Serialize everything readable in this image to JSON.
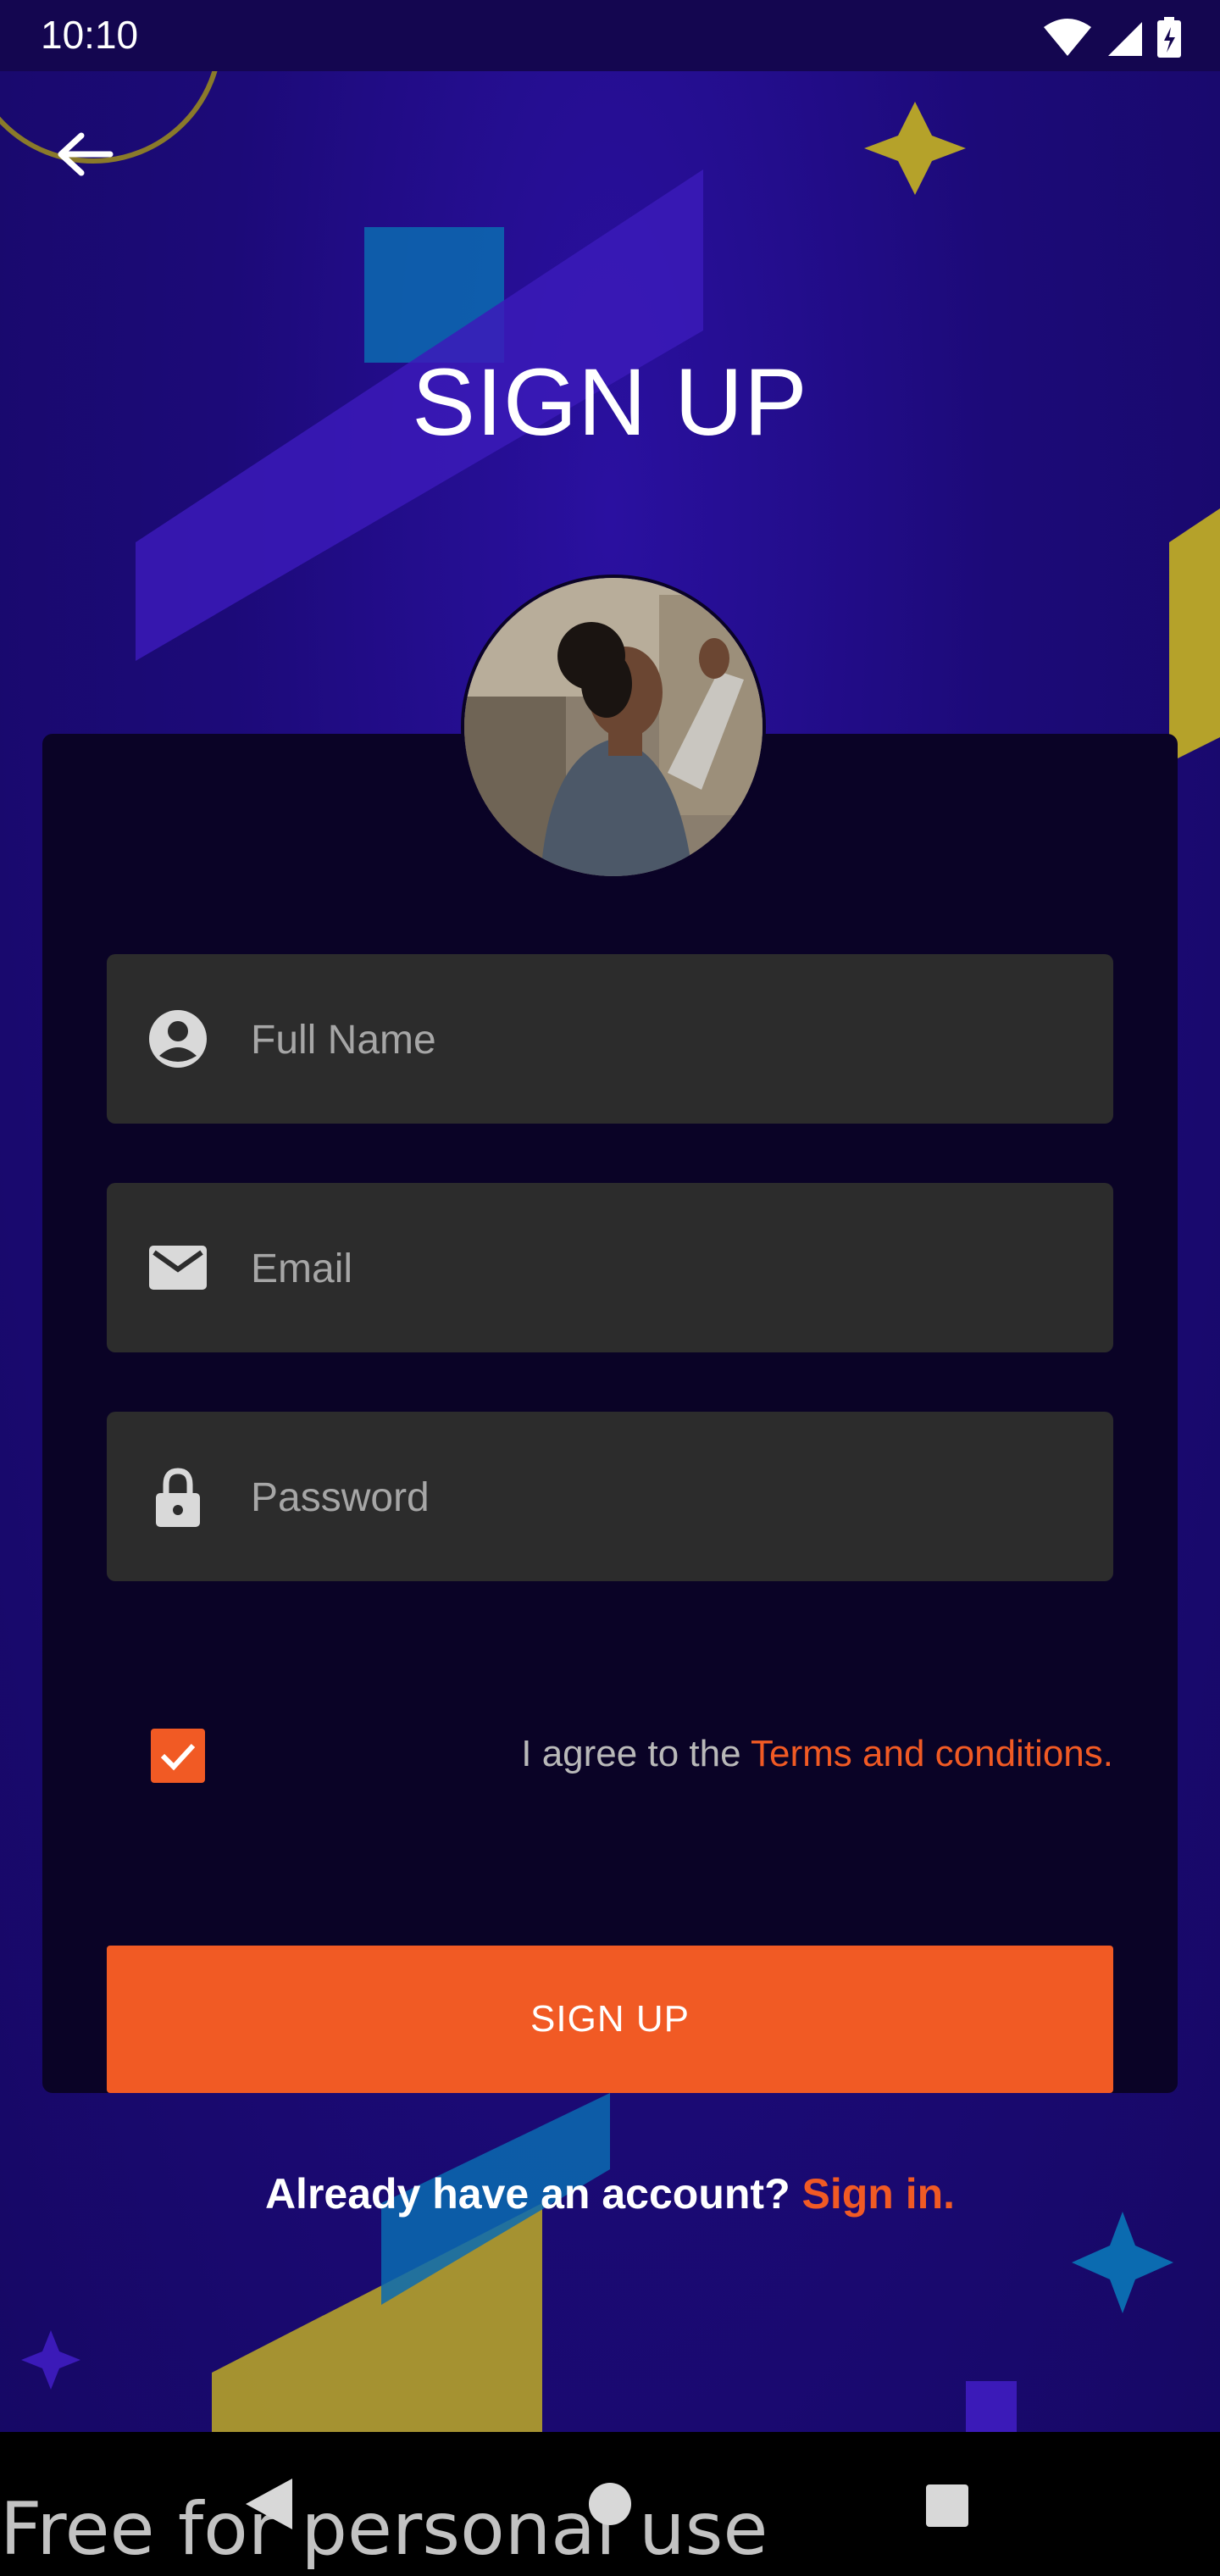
{
  "status_bar": {
    "time": "10:10"
  },
  "header": {
    "title": "SIGN UP"
  },
  "form": {
    "full_name": {
      "placeholder": "Full Name",
      "icon": "account-circle-icon"
    },
    "email": {
      "placeholder": "Email",
      "icon": "mail-icon"
    },
    "password": {
      "placeholder": "Password",
      "icon": "lock-icon"
    },
    "terms": {
      "checked": true,
      "prefix": "I agree to the ",
      "link": "Terms and conditions."
    },
    "submit_label": "SIGN UP"
  },
  "footer": {
    "prompt": "Already have an account? ",
    "link": "Sign in."
  },
  "watermark": "Free for personal use",
  "colors": {
    "accent": "#f15a24",
    "background": "#1c0a78",
    "card": "#0a0326",
    "field": "#2c2c2c"
  }
}
